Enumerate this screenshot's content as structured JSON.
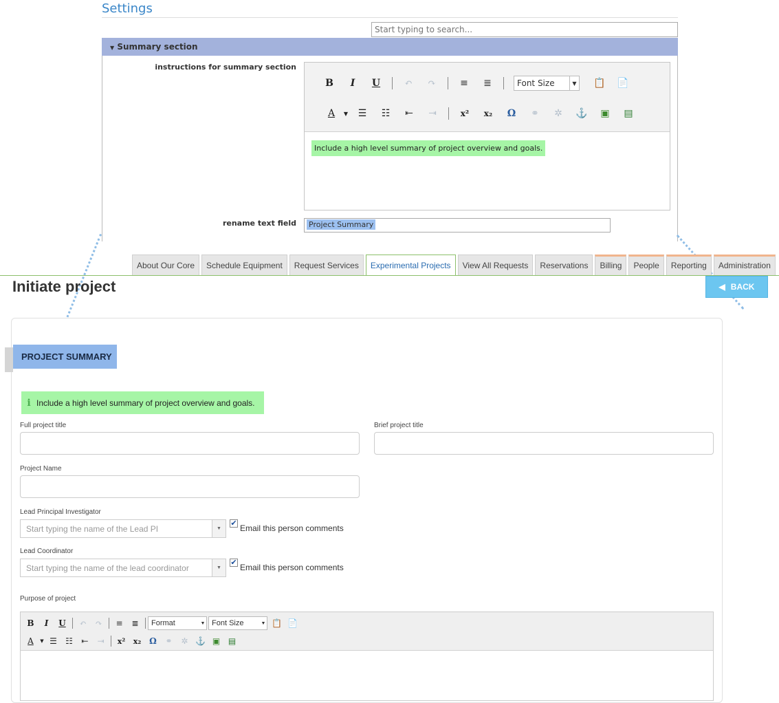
{
  "settings": {
    "title": "Settings",
    "search_placeholder": "Start typing to search...",
    "section_title": "Summary section",
    "instructions_label": "instructions for summary section",
    "editor_font_size": "Font Size",
    "editor_content": "Include a high level summary of project overview and goals.",
    "rename_label": "rename text field",
    "rename_value": "Project Summary"
  },
  "nav": {
    "tabs": [
      {
        "label": "About Our Core"
      },
      {
        "label": "Schedule Equipment"
      },
      {
        "label": "Request Services"
      },
      {
        "label": "Experimental Projects"
      },
      {
        "label": "View All Requests"
      },
      {
        "label": "Reservations"
      },
      {
        "label": "Billing"
      },
      {
        "label": "People"
      },
      {
        "label": "Reporting"
      },
      {
        "label": "Administration"
      }
    ],
    "active_tab": "Experimental Projects"
  },
  "page": {
    "title": "Initiate project",
    "back_label": "BACK",
    "section_ribbon": "PROJECT SUMMARY",
    "info_text": "Include a high level summary of project overview and goals.",
    "fields": {
      "full_title_label": "Full project title",
      "brief_title_label": "Brief project title",
      "project_name_label": "Project Name",
      "lead_pi_label": "Lead Principal Investigator",
      "lead_pi_placeholder": "Start typing the name of the Lead PI",
      "lead_coord_label": "Lead Coordinator",
      "lead_coord_placeholder": "Start typing the name of the lead coordinator",
      "email_comments_label": "Email this person comments",
      "purpose_label": "Purpose of project"
    },
    "editor": {
      "format_label": "Format",
      "font_size_label": "Font Size"
    }
  },
  "colors": {
    "section_bar": "#a3b2dc",
    "highlight_green": "#a6f5a6",
    "back_button": "#6cc6f0",
    "ribbon": "#8fb6ea",
    "active_tab_border": "#8bbf6a",
    "tab_accent": "#f0b48c"
  },
  "icons": [
    "bold-icon",
    "italic-icon",
    "underline-icon",
    "undo-icon",
    "redo-icon",
    "align-left-icon",
    "align-center-icon",
    "text-color-icon",
    "bullet-list-icon",
    "numbered-list-icon",
    "outdent-icon",
    "indent-icon",
    "superscript-icon",
    "subscript-icon",
    "omega-icon",
    "link-icon",
    "unlink-icon",
    "anchor-icon",
    "image-icon",
    "media-icon",
    "paste-text-icon",
    "paste-word-icon",
    "info-icon",
    "back-arrow-icon"
  ]
}
